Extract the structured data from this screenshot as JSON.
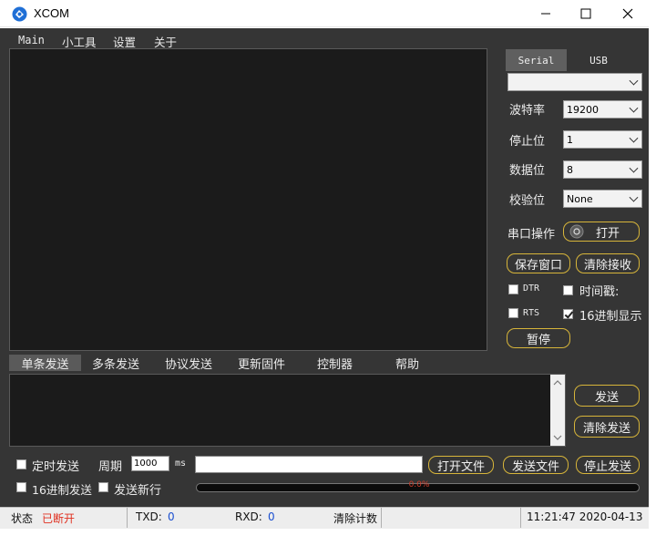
{
  "window": {
    "title": "XCOM"
  },
  "menu": {
    "items": [
      "Main",
      "小工具",
      "设置",
      "关于"
    ]
  },
  "port_tabs": {
    "serial": "Serial",
    "usb": "USB"
  },
  "serial_settings": {
    "port_value": "",
    "baud_label": "波特率",
    "baud_value": "19200",
    "stopbits_label": "停止位",
    "stopbits_value": "1",
    "databits_label": "数据位",
    "databits_value": "8",
    "parity_label": "校验位",
    "parity_value": "None",
    "port_op_label": "串口操作",
    "open_button": "打开"
  },
  "receive_controls": {
    "save_window": "保存窗口",
    "clear_receive": "清除接收",
    "dtr_label": "DTR",
    "dtr_checked": false,
    "timestamp_label": "时间戳:",
    "timestamp_checked": false,
    "rts_label": "RTS",
    "rts_checked": false,
    "hex_display_label": "16进制显示",
    "hex_display_checked": true,
    "pause_button": "暂停"
  },
  "send_tabs": [
    "单条发送",
    "多条发送",
    "协议发送",
    "更新固件",
    "控制器",
    "帮助"
  ],
  "send_panel": {
    "send_button": "发送",
    "clear_send_button": "清除发送",
    "timed_send_label": "定时发送",
    "timed_send_checked": false,
    "period_label": "周期",
    "period_value": "1000",
    "period_unit": "ms",
    "file_path_value": "",
    "open_file_button": "打开文件",
    "send_file_button": "发送文件",
    "stop_send_button": "停止发送",
    "hex_send_label": "16进制发送",
    "hex_send_checked": false,
    "newline_label": "发送新行",
    "newline_checked": false,
    "progress_text": "0.0%",
    "progress_value": 0
  },
  "status_bar": {
    "state_label": "状态",
    "state_value": "已断开",
    "txd_label": "TXD:",
    "txd_value": "0",
    "rxd_label": "RXD:",
    "rxd_value": "0",
    "clear_count": "清除计数",
    "datetime": "11:21:47 2020-04-13"
  },
  "colors": {
    "accent_border": "#d7b53a",
    "disconnected": "#e03020",
    "counter_blue": "#1a4fd0"
  }
}
